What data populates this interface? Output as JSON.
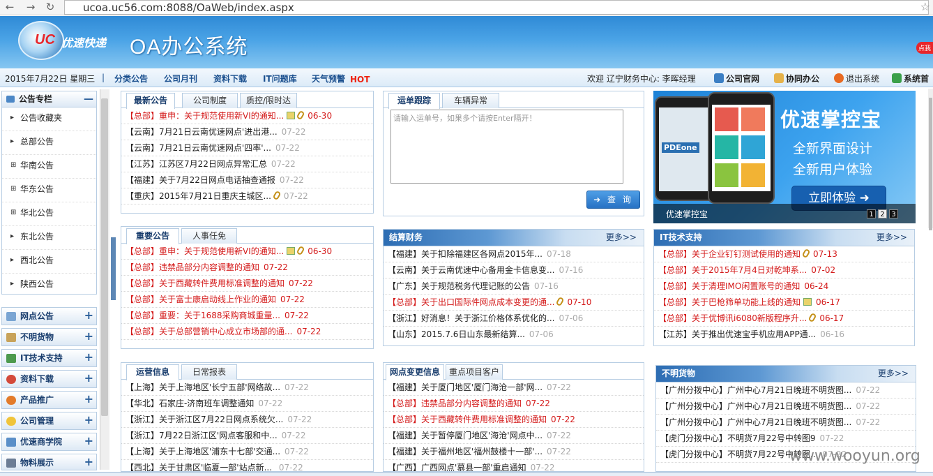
{
  "browser": {
    "url": "ucoa.uc56.com:8088/OaWeb/index.aspx"
  },
  "header": {
    "logo_text": "优速快递",
    "logo_mark": "UC",
    "title": "OA办公系统",
    "badge": "点我"
  },
  "menubar": {
    "date": "2015年7月22日 星期三",
    "sep": "|",
    "nav": [
      "分类公告",
      "公司月刊",
      "资料下载",
      "IT问题库",
      "天气预警"
    ],
    "hot": "HOT",
    "welcome": "欢迎 辽宁财务中心: 李晖经理",
    "links": [
      "公司官网",
      "协同办公",
      "退出系统",
      "系统首"
    ]
  },
  "sidebar": {
    "section_title": "公告专栏",
    "items": [
      "公告收藏夹",
      "总部公告",
      "华南公告",
      "华东公告",
      "华北公告",
      "东北公告",
      "西北公告",
      "陕西公告"
    ],
    "categories": [
      "网点公告",
      "不明货物",
      "IT技术支持",
      "资料下载",
      "产品推广",
      "公司管理",
      "优速商学院",
      "物料展示"
    ]
  },
  "panel_latest": {
    "tabs": [
      "最新公告",
      "公司制度",
      "质控/限时达"
    ],
    "rows": [
      {
        "text": "【总部】重申：关于规范使用新VI的通知...",
        "date": "06-30"
      },
      {
        "text": "【云南】7月21日云南优速网点'进出港...",
        "date": "07-22"
      },
      {
        "text": "【云南】7月21日云南优速网点'四率'...",
        "date": "07-22"
      },
      {
        "text": "【江苏】江苏区7月22日网点异常汇总",
        "date": "07-22"
      },
      {
        "text": "【福建】关于7月22日网点电话抽查通报",
        "date": "07-22"
      },
      {
        "text": "【重庆】2015年7月21日重庆主城区...",
        "date": "07-22"
      }
    ]
  },
  "panel_track": {
    "tabs": [
      "运单跟踪",
      "车辆异常"
    ],
    "placeholder": "请输入运单号，如果多个请按Enter隔开！",
    "button": "查 询"
  },
  "promo": {
    "title": "优速掌控宝",
    "line1": "全新界面设计",
    "line2": "全新用户体验",
    "button": "立即体验 ➜",
    "caption": "优速掌控宝",
    "pages": [
      "1",
      "2",
      "3"
    ],
    "phone_brand": "PDEone"
  },
  "panel_important": {
    "tabs": [
      "重要公告",
      "人事任免"
    ],
    "rows": [
      {
        "text": "【总部】重申：关于规范使用新VI的通知...",
        "date": "06-30"
      },
      {
        "text": "【总部】违禁品部分内容调整的通知",
        "date": "07-22"
      },
      {
        "text": "【总部】关于西藏转件费用标准调整的通知",
        "date": "07-22"
      },
      {
        "text": "【总部】关于富士康启动线上作业的通知",
        "date": "07-22"
      },
      {
        "text": "【总部】重要：关于1688采购商城重量...",
        "date": "07-22"
      },
      {
        "text": "【总部】关于总部营销中心成立市场部的通...",
        "date": "07-22"
      }
    ]
  },
  "panel_finance": {
    "title": "结算财务",
    "more": "更多>>",
    "rows": [
      {
        "text": "【福建】关于扣除福建区各网点2015年...",
        "date": "07-18"
      },
      {
        "text": "【云南】关于云南优速中心备用金卡信息变...",
        "date": "07-16"
      },
      {
        "text": "【广东】关于规范税务代理记账的公告",
        "date": "07-16"
      },
      {
        "text": "【总部】关于出口国际件网点成本变更的通...",
        "date": "07-10"
      },
      {
        "text": "【浙江】好消息！关于浙江价格体系优化的...",
        "date": "07-06"
      },
      {
        "text": "【山东】2015.7.6日山东最新结算...",
        "date": "07-06"
      }
    ]
  },
  "panel_it": {
    "title": "IT技术支持",
    "more": "更多>>",
    "rows": [
      {
        "text": "【总部】关于企业钉钉测试使用的通知",
        "date": "07-13"
      },
      {
        "text": "【总部】关于2015年7月4日对乾坤系...",
        "date": "07-02"
      },
      {
        "text": "【总部】关于清理IMO闲置账号的通知",
        "date": "06-24"
      },
      {
        "text": "【总部】关于巴枪筛单功能上线的通知",
        "date": "06-17"
      },
      {
        "text": "【总部】关于优博讯i6080新版程序升...",
        "date": "06-17"
      },
      {
        "text": "【江苏】关于推出优速宝手机应用APP通...",
        "date": "06-16"
      }
    ]
  },
  "panel_ops": {
    "tabs": [
      "运营信息",
      "日常报表"
    ],
    "rows": [
      {
        "text": "【上海】关于上海地区'长宁五部'网络故...",
        "date": "07-22"
      },
      {
        "text": "【华北】石家庄-济南班车调整通知",
        "date": "07-22"
      },
      {
        "text": "【浙江】关于浙江区7月22日网点系统欠...",
        "date": "07-22"
      },
      {
        "text": "【浙江】7月22日浙江区'网点客服和中...",
        "date": "07-22"
      },
      {
        "text": "【上海】关于上海地区'浦东十七部'交通...",
        "date": "07-22"
      },
      {
        "text": "【西北】关于甘肃区'临夏一部'站点新... ",
        "date": "07-22"
      }
    ]
  },
  "panel_netchange": {
    "tabs": [
      "网点变更信息",
      "重点项目客户"
    ],
    "rows": [
      {
        "text": "【福建】关于厦门地区'厦门海沧一部'网...",
        "date": "07-22"
      },
      {
        "text": "【总部】违禁品部分内容调整的通知",
        "date": "07-22"
      },
      {
        "text": "【总部】关于西藏转件费用标准调整的通知",
        "date": "07-22"
      },
      {
        "text": "【福建】关于暂停厦门地区'海沧'网点中...",
        "date": "07-22"
      },
      {
        "text": "【福建】关于福州地区'福州鼓楼十一部'...",
        "date": "07-22"
      },
      {
        "text": "【广西】广西网点'慕县一部'重启通知",
        "date": "07-22"
      }
    ]
  },
  "panel_unknown": {
    "title": "不明货物",
    "more": "更多>>",
    "rows": [
      {
        "text": "【广州分拨中心】广州中心7月21日晚班不明货图...",
        "date": "07-22"
      },
      {
        "text": "【广州分拨中心】广州中心7月21日晚班不明货图...",
        "date": "07-22"
      },
      {
        "text": "【广州分拨中心】广州中心7月21日晚班不明货图...",
        "date": "07-22"
      },
      {
        "text": "【虎门分拨中心】不明货7月22号中转图9",
        "date": "07-22"
      },
      {
        "text": "【虎门分拨中心】不明货7月22号中转图...",
        "date": "07-22"
      }
    ]
  },
  "watermark": "www.wooyun.org",
  "colors": {
    "accent": "#2f8ad6",
    "link": "#1a4f8e",
    "alert": "#d41a1a",
    "date": "#aaaaaa"
  }
}
